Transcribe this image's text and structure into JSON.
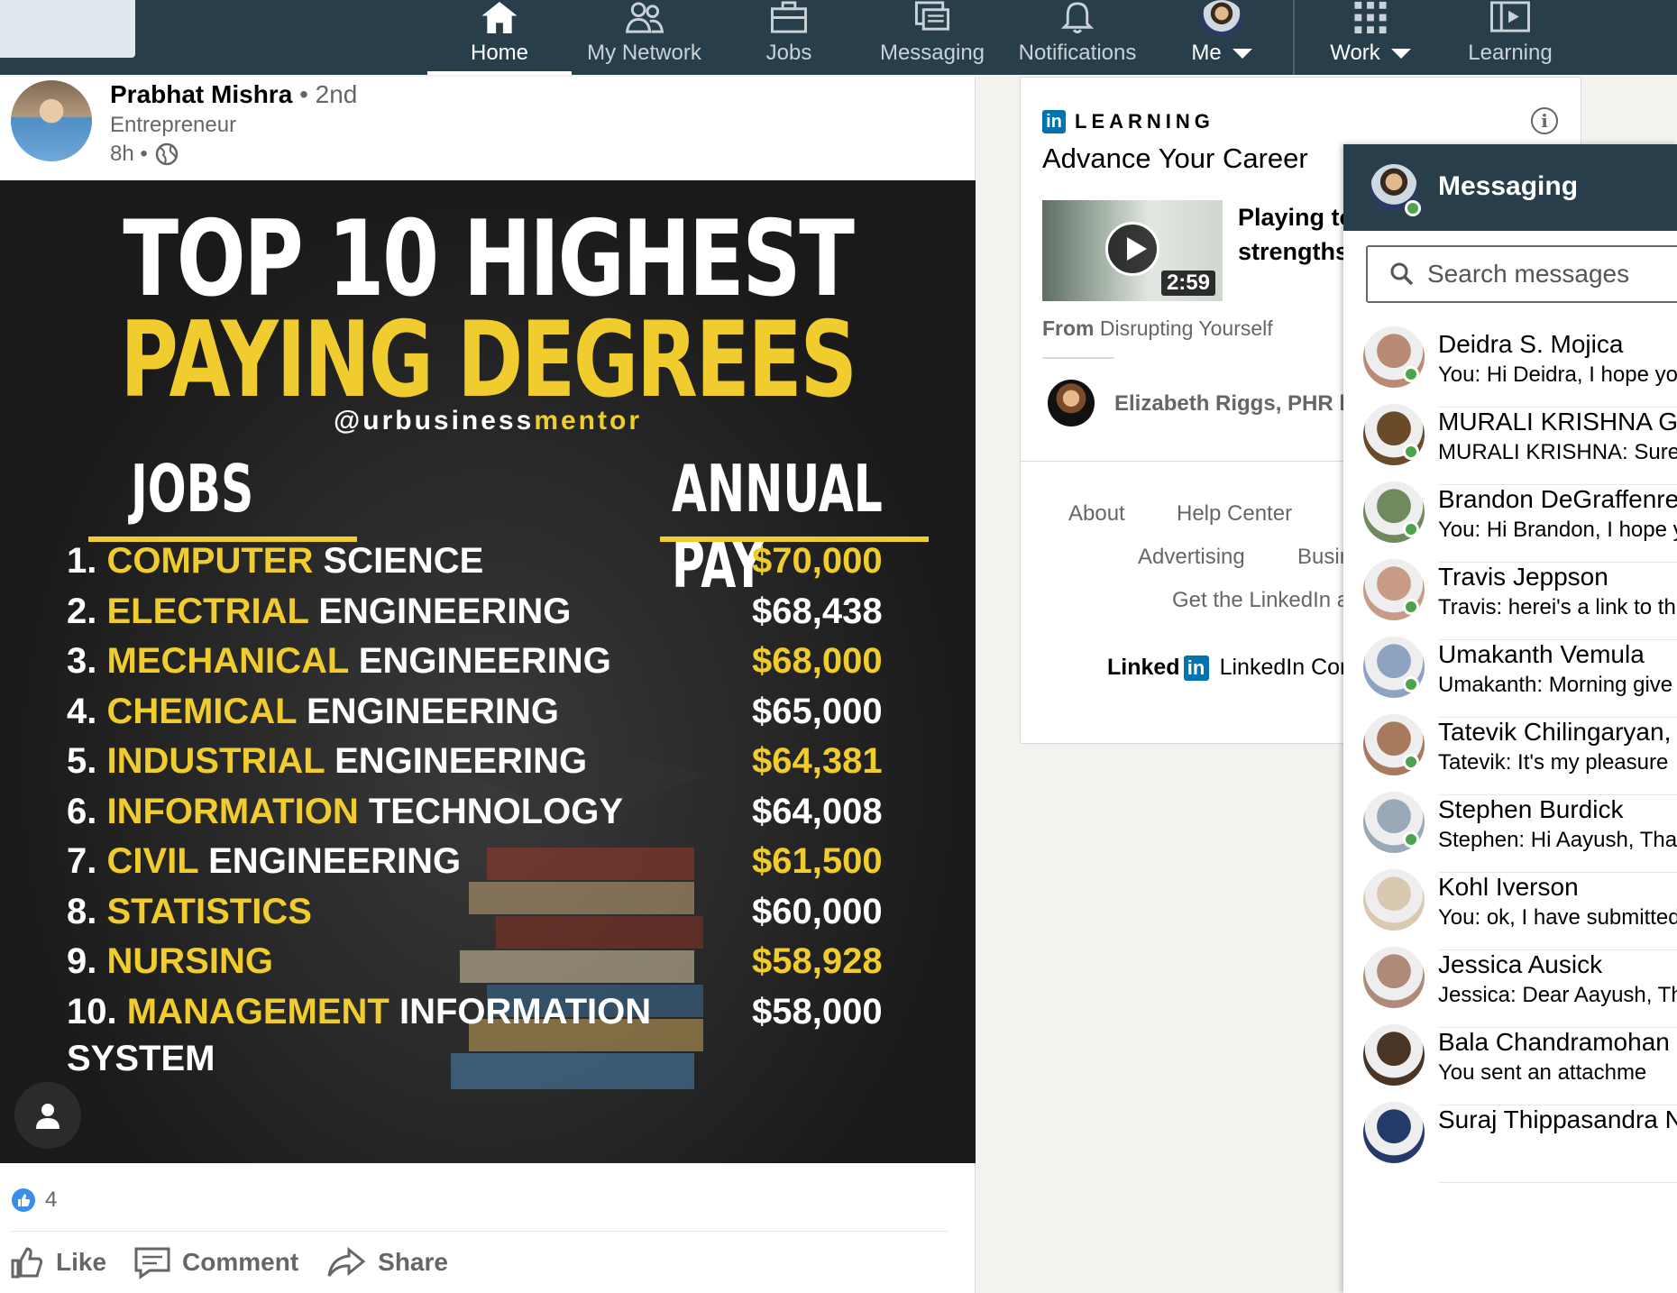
{
  "nav": {
    "items": [
      {
        "label": "Home",
        "icon": "home-icon"
      },
      {
        "label": "My Network",
        "icon": "network-icon"
      },
      {
        "label": "Jobs",
        "icon": "briefcase-icon"
      },
      {
        "label": "Messaging",
        "icon": "messaging-icon"
      },
      {
        "label": "Notifications",
        "icon": "bell-icon"
      },
      {
        "label": "Me",
        "icon": "avatar"
      },
      {
        "label": "Work",
        "icon": "grid-icon"
      },
      {
        "label": "Learning",
        "icon": "learning-icon"
      }
    ]
  },
  "post": {
    "author": "Prabhat Mishra",
    "degree": "• 2nd",
    "headline": "Entrepreneur",
    "time": "8h •",
    "image": {
      "title_line1": "TOP 10 HIGHEST",
      "title_line2": "PAYING DEGREES",
      "brand_a": "@urbusiness",
      "brand_b": "mentor",
      "col_jobs": "JOBS",
      "col_pay": "ANNUAL PAY",
      "rows": [
        {
          "num": "1.",
          "yellow": "COMPUTER",
          "white": "SCIENCE",
          "pay": "$70,000",
          "pay_yellow": true
        },
        {
          "num": "2.",
          "yellow": "ELECTRIAL",
          "white": "ENGINEERING",
          "pay": "$68,438",
          "pay_yellow": false
        },
        {
          "num": "3.",
          "yellow": "MECHANICAL",
          "white": "ENGINEERING",
          "pay": "$68,000",
          "pay_yellow": true
        },
        {
          "num": "4.",
          "yellow": "CHEMICAL",
          "white": "ENGINEERING",
          "pay": "$65,000",
          "pay_yellow": false
        },
        {
          "num": "5.",
          "yellow": "INDUSTRIAL",
          "white": "ENGINEERING",
          "pay": "$64,381",
          "pay_yellow": true
        },
        {
          "num": "6.",
          "yellow": "INFORMATION",
          "white": "TECHNOLOGY",
          "pay": "$64,008",
          "pay_yellow": false
        },
        {
          "num": "7.",
          "yellow": "CIVIL",
          "white": "ENGINEERING",
          "pay": "$61,500",
          "pay_yellow": true
        },
        {
          "num": "8.",
          "yellow": "STATISTICS",
          "white": "",
          "pay": "$60,000",
          "pay_yellow": false
        },
        {
          "num": "9.",
          "yellow": "NURSING",
          "white": "",
          "pay": "$58,928",
          "pay_yellow": true
        },
        {
          "num": "10.",
          "yellow": "MANAGEMENT",
          "white": "INFORMATION",
          "pay": "$58,000",
          "pay_yellow": false
        }
      ],
      "row_extra": "SYSTEM"
    },
    "reaction_count": "4",
    "actions": {
      "like": "Like",
      "comment": "Comment",
      "share": "Share"
    }
  },
  "learning": {
    "brand": "LEARNING",
    "brand_box": "in",
    "title": "Advance Your Career",
    "course_line1": "Playing to",
    "course_line2": "strengths",
    "duration": "2:59",
    "from_label": "From",
    "from_value": "Disrupting Yourself",
    "instructor": "Elizabeth Riggs, PHR li",
    "footer": {
      "about": "About",
      "help": "Help Center",
      "advertising": "Advertising",
      "business": "Busir",
      "app": "Get the LinkedIn a",
      "logo_text": "Linked",
      "logo_box": "in",
      "corp": "LinkedIn Corp"
    }
  },
  "messaging": {
    "title": "Messaging",
    "search_placeholder": "Search messages",
    "conversations": [
      {
        "name": "Deidra S. Mojica",
        "snippet": "You: Hi Deidra,  I hope yo",
        "online": true,
        "color": "#b98a74"
      },
      {
        "name": "MURALI KRISHNA GO",
        "snippet": "MURALI KRISHNA: Sure,",
        "online": true,
        "color": "#6b4a2a"
      },
      {
        "name": "Brandon DeGraffenrei",
        "snippet": "You: Hi Brandon,  I hope y",
        "online": true,
        "color": "#6f8a5c"
      },
      {
        "name": "Travis Jeppson",
        "snippet": "Travis: herei's a link to th",
        "online": true,
        "color": "#c79b84"
      },
      {
        "name": "Umakanth Vemula",
        "snippet": "Umakanth: Morning give",
        "online": true,
        "color": "#8ea2c2"
      },
      {
        "name": "Tatevik Chilingaryan, S",
        "snippet": "Tatevik: It's my pleasure",
        "online": true,
        "color": "#a77a5e"
      },
      {
        "name": "Stephen Burdick",
        "snippet": "Stephen: Hi Aayush,   Tha",
        "online": true,
        "color": "#9aa9b8"
      },
      {
        "name": "Kohl Iverson",
        "snippet": "You: ok, I have submitted",
        "online": false,
        "color": "#d8c9b0"
      },
      {
        "name": "Jessica Ausick",
        "snippet": "Jessica: Dear Aayush, Th",
        "online": false,
        "color": "#b08a78"
      },
      {
        "name": "Bala Chandramohan",
        "snippet": "You sent an attachme",
        "online": false,
        "color": "#4a3424"
      },
      {
        "name": "Suraj Thippasandra N",
        "snippet": "",
        "online": false,
        "color": "#233a6a"
      }
    ]
  }
}
